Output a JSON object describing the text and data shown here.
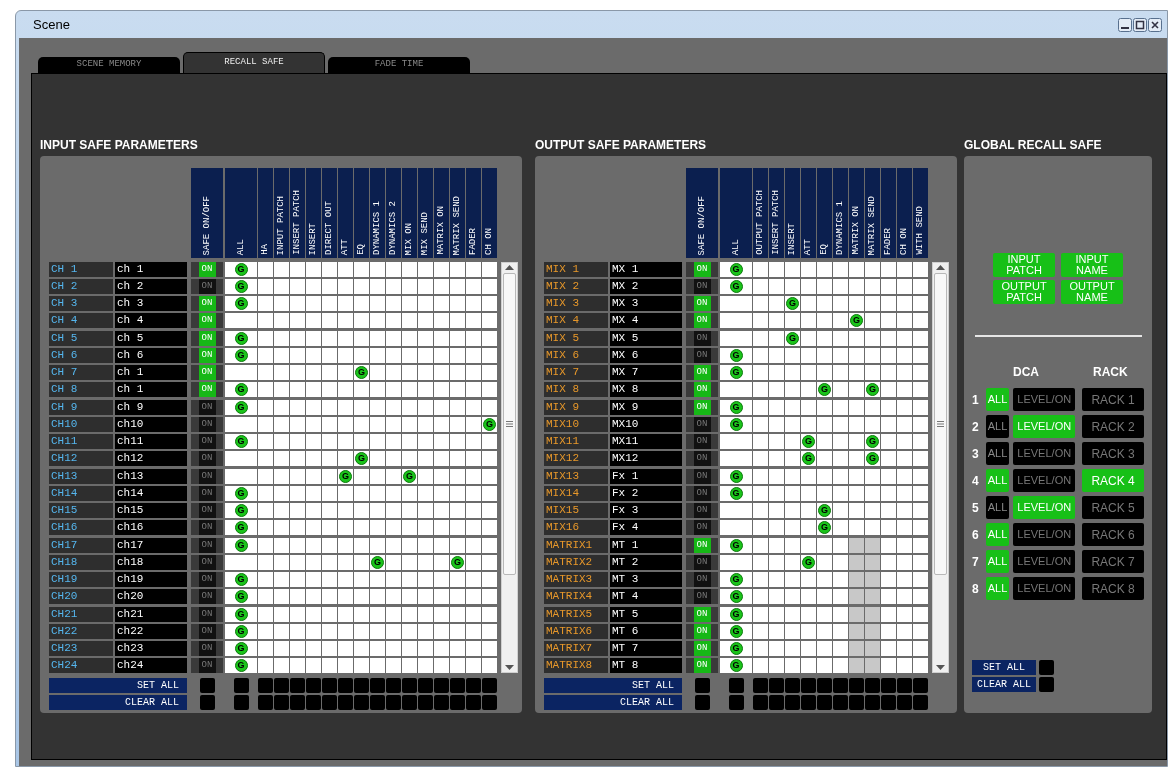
{
  "window": {
    "title": "Scene"
  },
  "tabs": [
    {
      "label": "SCENE MEMORY",
      "selected": false
    },
    {
      "label": "RECALL SAFE",
      "selected": true
    },
    {
      "label": "FADE TIME",
      "selected": false
    }
  ],
  "input_section": {
    "title": "INPUT SAFE PARAMETERS",
    "safe_column": "SAFE ON/OFF",
    "columns": [
      "ALL",
      "HA",
      "INPUT PATCH",
      "INSERT PATCH",
      "INSERT",
      "DIRECT OUT",
      "ATT",
      "EQ",
      "DYNAMICS 1",
      "DYNAMICS 2",
      "MIX ON",
      "MIX SEND",
      "MATRIX ON",
      "MATRIX SEND",
      "FADER",
      "CH ON"
    ],
    "rows": [
      {
        "label": "CH 1",
        "name": "ch 1",
        "safe_on": true,
        "safe_text": "ON",
        "cells": [
          {
            "mark": "G"
          },
          null,
          null,
          null,
          null,
          null,
          null,
          null,
          null,
          null,
          null,
          null,
          null,
          null,
          null,
          null
        ]
      },
      {
        "label": "CH 2",
        "name": "ch 2",
        "safe_on": false,
        "safe_text": "ON",
        "cells": [
          {
            "mark": "G"
          },
          null,
          null,
          null,
          null,
          null,
          null,
          null,
          null,
          null,
          null,
          null,
          null,
          null,
          null,
          null
        ]
      },
      {
        "label": "CH 3",
        "name": "ch 3",
        "safe_on": true,
        "safe_text": "ON",
        "cells": [
          {
            "mark": "G"
          },
          null,
          null,
          null,
          null,
          null,
          null,
          null,
          null,
          null,
          null,
          null,
          null,
          null,
          null,
          null
        ]
      },
      {
        "label": "CH 4",
        "name": "ch 4",
        "safe_on": true,
        "safe_text": "ON",
        "cells": [
          null,
          null,
          null,
          null,
          null,
          null,
          null,
          null,
          null,
          null,
          null,
          null,
          null,
          null,
          null,
          null
        ]
      },
      {
        "label": "CH 5",
        "name": "ch 5",
        "safe_on": true,
        "safe_text": "ON",
        "cells": [
          {
            "mark": "G"
          },
          null,
          null,
          null,
          null,
          null,
          null,
          null,
          null,
          null,
          null,
          null,
          null,
          null,
          null,
          null
        ]
      },
      {
        "label": "CH 6",
        "name": "ch 6",
        "safe_on": true,
        "safe_text": "ON",
        "cells": [
          {
            "mark": "G"
          },
          null,
          null,
          null,
          null,
          null,
          null,
          null,
          null,
          null,
          null,
          null,
          null,
          null,
          null,
          null
        ]
      },
      {
        "label": "CH 7",
        "name": "ch 1",
        "safe_on": true,
        "safe_text": "ON",
        "cells": [
          null,
          null,
          null,
          null,
          null,
          null,
          null,
          {
            "mark": "G"
          },
          null,
          null,
          null,
          null,
          null,
          null,
          null,
          null
        ]
      },
      {
        "label": "CH 8",
        "name": "ch 1",
        "safe_on": true,
        "safe_text": "ON",
        "cells": [
          {
            "mark": "G"
          },
          null,
          null,
          null,
          null,
          null,
          null,
          null,
          null,
          null,
          null,
          null,
          null,
          null,
          null,
          null
        ]
      },
      {
        "label": "CH 9",
        "name": "ch 9",
        "safe_on": false,
        "safe_text": "ON",
        "cells": [
          {
            "mark": "G"
          },
          null,
          null,
          null,
          null,
          null,
          null,
          null,
          null,
          null,
          null,
          null,
          null,
          null,
          null,
          null
        ]
      },
      {
        "label": "CH10",
        "name": "ch10",
        "safe_on": false,
        "safe_text": "ON",
        "cells": [
          null,
          null,
          null,
          null,
          null,
          null,
          null,
          null,
          null,
          null,
          null,
          null,
          null,
          null,
          null,
          {
            "mark": "G"
          }
        ]
      },
      {
        "label": "CH11",
        "name": "ch11",
        "safe_on": false,
        "safe_text": "ON",
        "cells": [
          {
            "mark": "G"
          },
          null,
          null,
          null,
          null,
          null,
          null,
          null,
          null,
          null,
          null,
          null,
          null,
          null,
          null,
          null
        ]
      },
      {
        "label": "CH12",
        "name": "ch12",
        "safe_on": false,
        "safe_text": "ON",
        "cells": [
          null,
          null,
          null,
          null,
          null,
          null,
          null,
          {
            "mark": "G"
          },
          null,
          null,
          null,
          null,
          null,
          null,
          null,
          null
        ]
      },
      {
        "label": "CH13",
        "name": "ch13",
        "safe_on": false,
        "safe_text": "ON",
        "cells": [
          null,
          null,
          null,
          null,
          null,
          null,
          {
            "mark": "G"
          },
          null,
          null,
          null,
          {
            "mark": "G"
          },
          null,
          null,
          null,
          null,
          null
        ]
      },
      {
        "label": "CH14",
        "name": "ch14",
        "safe_on": false,
        "safe_text": "ON",
        "cells": [
          {
            "mark": "G"
          },
          null,
          null,
          null,
          null,
          null,
          null,
          null,
          null,
          null,
          null,
          null,
          null,
          null,
          null,
          null
        ]
      },
      {
        "label": "CH15",
        "name": "ch15",
        "safe_on": false,
        "safe_text": "ON",
        "cells": [
          {
            "mark": "G"
          },
          null,
          null,
          null,
          null,
          null,
          null,
          null,
          null,
          null,
          null,
          null,
          null,
          null,
          null,
          null
        ]
      },
      {
        "label": "CH16",
        "name": "ch16",
        "safe_on": false,
        "safe_text": "ON",
        "cells": [
          {
            "mark": "G"
          },
          null,
          null,
          null,
          null,
          null,
          null,
          null,
          null,
          null,
          null,
          null,
          null,
          null,
          null,
          null
        ]
      },
      {
        "label": "CH17",
        "name": "ch17",
        "safe_on": false,
        "safe_text": "ON",
        "cells": [
          {
            "mark": "G"
          },
          null,
          null,
          null,
          null,
          null,
          null,
          null,
          null,
          null,
          null,
          null,
          null,
          null,
          null,
          null
        ]
      },
      {
        "label": "CH18",
        "name": "ch18",
        "safe_on": false,
        "safe_text": "ON",
        "cells": [
          null,
          null,
          null,
          null,
          null,
          null,
          null,
          null,
          {
            "mark": "G"
          },
          null,
          null,
          null,
          null,
          {
            "mark": "G"
          },
          null,
          null
        ]
      },
      {
        "label": "CH19",
        "name": "ch19",
        "safe_on": false,
        "safe_text": "ON",
        "cells": [
          {
            "mark": "G"
          },
          null,
          null,
          null,
          null,
          null,
          null,
          null,
          null,
          null,
          null,
          null,
          null,
          null,
          null,
          null
        ]
      },
      {
        "label": "CH20",
        "name": "ch20",
        "safe_on": false,
        "safe_text": "ON",
        "cells": [
          {
            "mark": "G"
          },
          null,
          null,
          null,
          null,
          null,
          null,
          null,
          null,
          null,
          null,
          null,
          null,
          null,
          null,
          null
        ]
      },
      {
        "label": "CH21",
        "name": "ch21",
        "safe_on": false,
        "safe_text": "ON",
        "cells": [
          {
            "mark": "G"
          },
          null,
          null,
          null,
          null,
          null,
          null,
          null,
          null,
          null,
          null,
          null,
          null,
          null,
          null,
          null
        ]
      },
      {
        "label": "CH22",
        "name": "ch22",
        "safe_on": false,
        "safe_text": "ON",
        "cells": [
          {
            "mark": "G"
          },
          null,
          null,
          null,
          null,
          null,
          null,
          null,
          null,
          null,
          null,
          null,
          null,
          null,
          null,
          null
        ]
      },
      {
        "label": "CH23",
        "name": "ch23",
        "safe_on": false,
        "safe_text": "ON",
        "cells": [
          {
            "mark": "G"
          },
          null,
          null,
          null,
          null,
          null,
          null,
          null,
          null,
          null,
          null,
          null,
          null,
          null,
          null,
          null
        ]
      },
      {
        "label": "CH24",
        "name": "ch24",
        "safe_on": false,
        "safe_text": "ON",
        "cells": [
          {
            "mark": "G"
          },
          null,
          null,
          null,
          null,
          null,
          null,
          null,
          null,
          null,
          null,
          null,
          null,
          null,
          null,
          null
        ]
      }
    ],
    "set_all": "SET ALL",
    "clear_all": "CLEAR ALL"
  },
  "output_section": {
    "title": "OUTPUT SAFE PARAMETERS",
    "safe_column": "SAFE ON/OFF",
    "columns": [
      "ALL",
      "OUTPUT PATCH",
      "INSERT PATCH",
      "INSERT",
      "ATT",
      "EQ",
      "DYNAMICS 1",
      "MATRIX ON",
      "MATRIX SEND",
      "FADER",
      "CH ON",
      "WITH SEND"
    ],
    "rows": [
      {
        "label": "MIX 1",
        "name": "MX 1",
        "safe_on": true,
        "safe_text": "ON",
        "cells": [
          {
            "mark": "G"
          },
          null,
          null,
          null,
          null,
          null,
          null,
          null,
          null,
          null,
          null,
          null
        ]
      },
      {
        "label": "MIX 2",
        "name": "MX 2",
        "safe_on": false,
        "safe_text": "ON",
        "cells": [
          {
            "mark": "G"
          },
          null,
          null,
          null,
          null,
          null,
          null,
          null,
          null,
          null,
          null,
          null
        ]
      },
      {
        "label": "MIX 3",
        "name": "MX 3",
        "safe_on": true,
        "safe_text": "ON",
        "cells": [
          null,
          null,
          null,
          {
            "mark": "G"
          },
          null,
          null,
          null,
          null,
          null,
          null,
          null,
          null
        ]
      },
      {
        "label": "MIX 4",
        "name": "MX 4",
        "safe_on": true,
        "safe_text": "ON",
        "cells": [
          null,
          null,
          null,
          null,
          null,
          null,
          null,
          {
            "mark": "G"
          },
          null,
          null,
          null,
          null
        ]
      },
      {
        "label": "MIX 5",
        "name": "MX 5",
        "safe_on": false,
        "safe_text": "ON",
        "cells": [
          null,
          null,
          null,
          {
            "mark": "G"
          },
          null,
          null,
          null,
          null,
          null,
          null,
          null,
          null
        ]
      },
      {
        "label": "MIX 6",
        "name": "MX 6",
        "safe_on": false,
        "safe_text": "ON",
        "cells": [
          {
            "mark": "G"
          },
          null,
          null,
          null,
          null,
          null,
          null,
          null,
          null,
          null,
          null,
          null
        ]
      },
      {
        "label": "MIX 7",
        "name": "MX 7",
        "safe_on": true,
        "safe_text": "ON",
        "cells": [
          {
            "mark": "G"
          },
          null,
          null,
          null,
          null,
          null,
          null,
          null,
          null,
          null,
          null,
          null
        ]
      },
      {
        "label": "MIX 8",
        "name": "MX 8",
        "safe_on": true,
        "safe_text": "ON",
        "cells": [
          null,
          null,
          null,
          null,
          null,
          {
            "mark": "G"
          },
          null,
          null,
          {
            "mark": "G"
          },
          null,
          null,
          null
        ]
      },
      {
        "label": "MIX 9",
        "name": "MX 9",
        "safe_on": true,
        "safe_text": "ON",
        "cells": [
          {
            "mark": "G"
          },
          null,
          null,
          null,
          null,
          null,
          null,
          null,
          null,
          null,
          null,
          null
        ]
      },
      {
        "label": "MIX10",
        "name": "MX10",
        "safe_on": false,
        "safe_text": "ON",
        "cells": [
          {
            "mark": "G"
          },
          null,
          null,
          null,
          null,
          null,
          null,
          null,
          null,
          null,
          null,
          null
        ]
      },
      {
        "label": "MIX11",
        "name": "MX11",
        "safe_on": false,
        "safe_text": "ON",
        "cells": [
          null,
          null,
          null,
          null,
          {
            "mark": "G"
          },
          null,
          null,
          null,
          {
            "mark": "G"
          },
          null,
          null,
          null
        ]
      },
      {
        "label": "MIX12",
        "name": "MX12",
        "safe_on": false,
        "safe_text": "ON",
        "cells": [
          null,
          null,
          null,
          null,
          {
            "mark": "G"
          },
          null,
          null,
          null,
          {
            "mark": "G"
          },
          null,
          null,
          null
        ]
      },
      {
        "label": "MIX13",
        "name": "Fx 1",
        "safe_on": false,
        "safe_text": "ON",
        "cells": [
          {
            "mark": "G"
          },
          null,
          null,
          null,
          null,
          null,
          null,
          null,
          null,
          null,
          null,
          null
        ]
      },
      {
        "label": "MIX14",
        "name": "Fx 2",
        "safe_on": false,
        "safe_text": "ON",
        "cells": [
          {
            "mark": "G"
          },
          null,
          null,
          null,
          null,
          null,
          null,
          null,
          null,
          null,
          null,
          null
        ]
      },
      {
        "label": "MIX15",
        "name": "Fx 3",
        "safe_on": false,
        "safe_text": "ON",
        "cells": [
          null,
          null,
          null,
          null,
          null,
          {
            "mark": "G"
          },
          null,
          null,
          null,
          null,
          null,
          null
        ]
      },
      {
        "label": "MIX16",
        "name": "Fx 4",
        "safe_on": false,
        "safe_text": "ON",
        "cells": [
          null,
          null,
          null,
          null,
          null,
          {
            "mark": "G"
          },
          null,
          null,
          null,
          null,
          null,
          null
        ]
      },
      {
        "label": "MATRIX1",
        "name": "MT 1",
        "safe_on": true,
        "safe_text": "ON",
        "cells": [
          {
            "mark": "G"
          },
          null,
          null,
          null,
          null,
          null,
          null,
          {
            "disabled": true
          },
          {
            "disabled": true
          },
          null,
          null,
          null
        ]
      },
      {
        "label": "MATRIX2",
        "name": "MT 2",
        "safe_on": false,
        "safe_text": "ON",
        "cells": [
          null,
          null,
          null,
          null,
          {
            "mark": "G"
          },
          null,
          null,
          {
            "disabled": true
          },
          {
            "disabled": true
          },
          null,
          null,
          null
        ]
      },
      {
        "label": "MATRIX3",
        "name": "MT 3",
        "safe_on": false,
        "safe_text": "ON",
        "cells": [
          {
            "mark": "G"
          },
          null,
          null,
          null,
          null,
          null,
          null,
          {
            "disabled": true
          },
          {
            "disabled": true
          },
          null,
          null,
          null
        ]
      },
      {
        "label": "MATRIX4",
        "name": "MT 4",
        "safe_on": false,
        "safe_text": "ON",
        "cells": [
          {
            "mark": "G"
          },
          null,
          null,
          null,
          null,
          null,
          null,
          {
            "disabled": true
          },
          {
            "disabled": true
          },
          null,
          null,
          null
        ]
      },
      {
        "label": "MATRIX5",
        "name": "MT 5",
        "safe_on": true,
        "safe_text": "ON",
        "cells": [
          {
            "mark": "G"
          },
          null,
          null,
          null,
          null,
          null,
          null,
          {
            "disabled": true
          },
          {
            "disabled": true
          },
          null,
          null,
          null
        ]
      },
      {
        "label": "MATRIX6",
        "name": "MT 6",
        "safe_on": true,
        "safe_text": "ON",
        "cells": [
          {
            "mark": "G"
          },
          null,
          null,
          null,
          null,
          null,
          null,
          {
            "disabled": true
          },
          {
            "disabled": true
          },
          null,
          null,
          null
        ]
      },
      {
        "label": "MATRIX7",
        "name": "MT 7",
        "safe_on": true,
        "safe_text": "ON",
        "cells": [
          {
            "mark": "G"
          },
          null,
          null,
          null,
          null,
          null,
          null,
          {
            "disabled": true
          },
          {
            "disabled": true
          },
          null,
          null,
          null
        ]
      },
      {
        "label": "MATRIX8",
        "name": "MT 8",
        "safe_on": true,
        "safe_text": "ON",
        "cells": [
          {
            "mark": "G"
          },
          null,
          null,
          null,
          null,
          null,
          null,
          {
            "disabled": true
          },
          {
            "disabled": true
          },
          null,
          null,
          null
        ]
      }
    ],
    "set_all": "SET ALL",
    "clear_all": "CLEAR ALL"
  },
  "global_section": {
    "title": "GLOBAL RECALL SAFE",
    "buttons": [
      {
        "label": "INPUT PATCH",
        "on": true
      },
      {
        "label": "INPUT NAME",
        "on": true
      },
      {
        "label": "OUTPUT PATCH",
        "on": true
      },
      {
        "label": "OUTPUT NAME",
        "on": true
      }
    ],
    "dca_header": "DCA",
    "rack_header": "RACK",
    "rows": [
      {
        "number": "1",
        "all": {
          "label": "ALL",
          "on": true
        },
        "level_on": {
          "label": "LEVEL/ON",
          "on": false
        },
        "rack": {
          "label": "RACK 1",
          "on": false
        }
      },
      {
        "number": "2",
        "all": {
          "label": "ALL",
          "on": false
        },
        "level_on": {
          "label": "LEVEL/ON",
          "on": true
        },
        "rack": {
          "label": "RACK 2",
          "on": false
        }
      },
      {
        "number": "3",
        "all": {
          "label": "ALL",
          "on": false
        },
        "level_on": {
          "label": "LEVEL/ON",
          "on": false
        },
        "rack": {
          "label": "RACK 3",
          "on": false
        }
      },
      {
        "number": "4",
        "all": {
          "label": "ALL",
          "on": true
        },
        "level_on": {
          "label": "LEVEL/ON",
          "on": false
        },
        "rack": {
          "label": "RACK 4",
          "on": true
        }
      },
      {
        "number": "5",
        "all": {
          "label": "ALL",
          "on": false
        },
        "level_on": {
          "label": "LEVEL/ON",
          "on": true
        },
        "rack": {
          "label": "RACK 5",
          "on": false
        }
      },
      {
        "number": "6",
        "all": {
          "label": "ALL",
          "on": true
        },
        "level_on": {
          "label": "LEVEL/ON",
          "on": false
        },
        "rack": {
          "label": "RACK 6",
          "on": false
        }
      },
      {
        "number": "7",
        "all": {
          "label": "ALL",
          "on": true
        },
        "level_on": {
          "label": "LEVEL/ON",
          "on": false
        },
        "rack": {
          "label": "RACK 7",
          "on": false
        }
      },
      {
        "number": "8",
        "all": {
          "label": "ALL",
          "on": true
        },
        "level_on": {
          "label": "LEVEL/ON",
          "on": false
        },
        "rack": {
          "label": "RACK 8",
          "on": false
        }
      }
    ],
    "set_all": "SET ALL",
    "clear_all": "CLEAR ALL"
  }
}
